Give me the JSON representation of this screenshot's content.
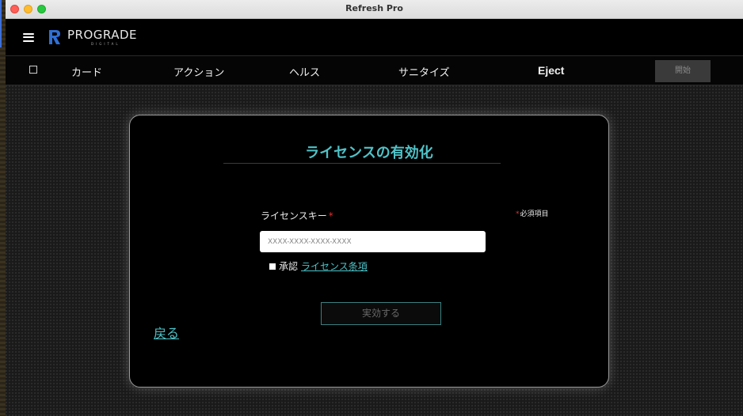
{
  "window": {
    "title": "Refresh Pro"
  },
  "appbar": {
    "logo_text": "PROGRADE",
    "logo_subtext": "DIGITAL",
    "brand_color": "#2f6fd6"
  },
  "nav": {
    "items": [
      {
        "label": "カード"
      },
      {
        "label": "アクション"
      },
      {
        "label": "ヘルス"
      },
      {
        "label": "サニタイズ"
      },
      {
        "label": "Eject"
      }
    ],
    "start_label": "開始"
  },
  "card": {
    "title": "ライセンスの有効化",
    "field_label": "ライセンスキー",
    "required_mark": "*",
    "required_note": "必須項目",
    "input_placeholder": "XXXX-XXXX-XXXX-XXXX",
    "input_value": "",
    "agree_text": "承認",
    "agree_link": "ライセンス条項",
    "activate_label": "実効する",
    "back_label": "戻る"
  },
  "colors": {
    "accent": "#4ec3c8",
    "required": "#e03030",
    "background": "#000000"
  }
}
